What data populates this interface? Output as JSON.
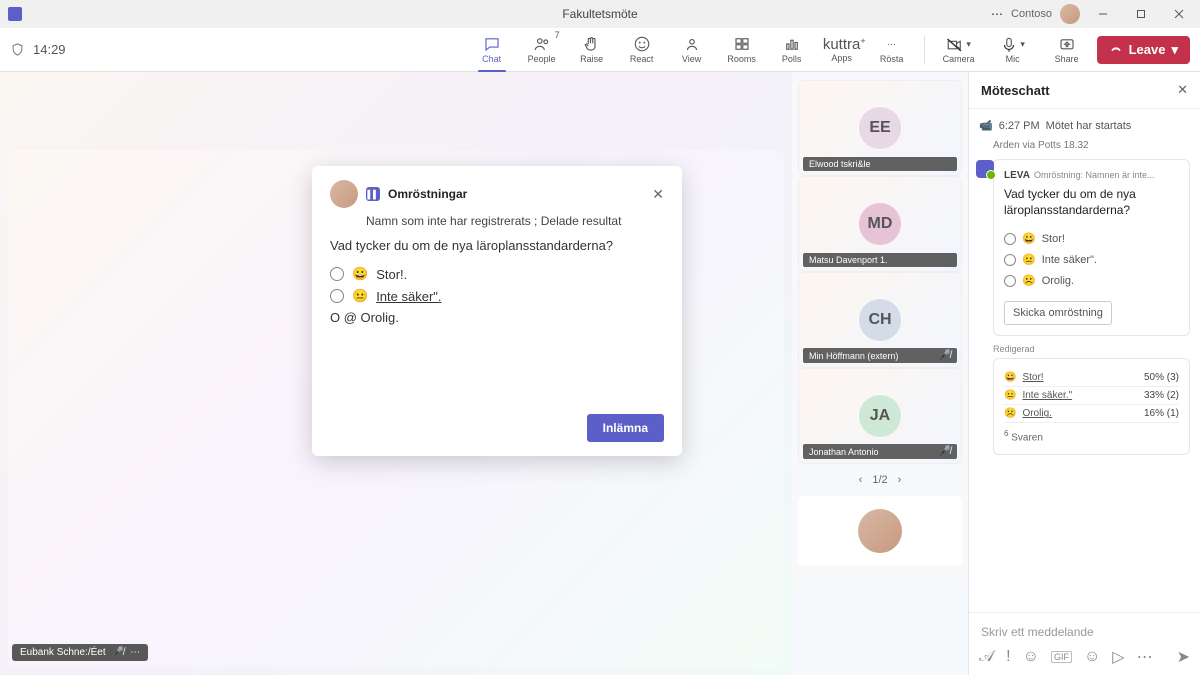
{
  "titlebar": {
    "title": "Fakultetsmöte",
    "org": "Contoso"
  },
  "toolbar": {
    "time": "14:29",
    "buttons": {
      "chat": "Chat",
      "people": "People",
      "people_count": "7",
      "raise": "Raise",
      "react": "React",
      "view": "View",
      "rooms": "Rooms",
      "polls": "Polls",
      "apps": "Apps"
    },
    "rosta": "kuttra",
    "rosta_label": "Rösta",
    "camera": "Camera",
    "mic": "Mic",
    "share": "Share",
    "leave": "Leave"
  },
  "self_pill": "Eubank Schne:/Éet",
  "poll": {
    "app": "Omröstningar",
    "sub": "Namn som inte har registrerats ; Delade resultat",
    "question": "Vad tycker du om de nya läroplansstandarderna?",
    "options": [
      "Stor!.",
      "Inte säker\".",
      "O @ Orolig."
    ],
    "emoji": [
      "😀",
      "😐"
    ],
    "submit": "Inlämna"
  },
  "participants": [
    {
      "initials": "EE",
      "name": "Elwood tskri&ample",
      "color": "#e8d7e4",
      "muted": false
    },
    {
      "initials": "MD",
      "name": "Matsu Davenport 1.",
      "color": "#e6c4d6",
      "muted": false
    },
    {
      "initials": "CH",
      "name": "Min Höffmann (extern)",
      "color": "#d3dce8",
      "muted": true
    },
    {
      "initials": "JA",
      "name": "Jonathan Antonio",
      "color": "#cfe8d6",
      "muted": true
    }
  ],
  "pager": "1/2",
  "chat": {
    "header": "Möteschatt",
    "started_time": "6:27 PM",
    "started_text": "Mötet har startats",
    "from": "Arden via Potts 18.32",
    "card": {
      "badge": "LEVA",
      "meta": "Omröstning: Namnen är inte...",
      "question": "Vad tycker du om de nya läroplansstandarderna?",
      "options": [
        {
          "e": "😀",
          "t": "Stor!"
        },
        {
          "e": "😐",
          "t": "Inte säker\"."
        },
        {
          "e": "☹️",
          "t": "Orolig."
        }
      ],
      "send": "Skicka omröstning"
    },
    "edited": "Redigerad",
    "results": [
      {
        "e": "😀",
        "t": "Stor!",
        "p": "50% (3)"
      },
      {
        "e": "😐",
        "t": "Inte säker.\"",
        "p": "33% (2)"
      },
      {
        "e": "☹️",
        "t": "Orolig.",
        "p": "16% (1)"
      }
    ],
    "answers_n": "6",
    "answers_label": "Svaren",
    "compose_placeholder": "Skriv ett meddelande"
  }
}
